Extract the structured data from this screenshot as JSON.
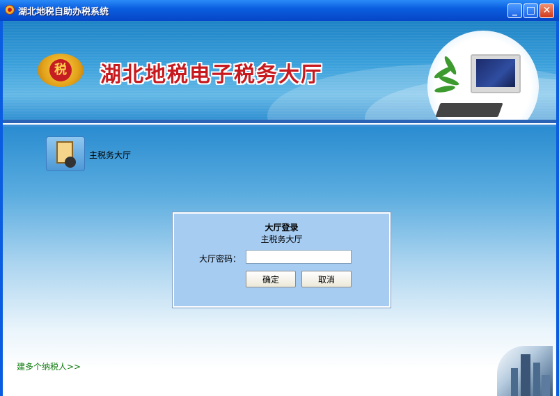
{
  "window": {
    "title": "湖北地税自助办税系统",
    "min_symbol": "_",
    "max_symbol": "□",
    "close_symbol": "✕"
  },
  "banner": {
    "title": "湖北地税电子税务大厅",
    "emblem_char": "税"
  },
  "hall": {
    "label": "主税务大厅"
  },
  "login": {
    "title": "大厅登录",
    "subtitle": "主税务大厅",
    "password_label": "大厅密码：",
    "password_value": "",
    "ok_label": "确定",
    "cancel_label": "取消"
  },
  "footer": {
    "multi_taxpayer_link": "建多个纳税人>>"
  },
  "icons": {
    "app": "tax-emblem-icon",
    "hall": "clipboard-person-icon"
  },
  "colors": {
    "title_bar": "#0b5ee0",
    "banner_title": "#c71a1f",
    "login_panel": "#a6ccf2",
    "link": "#0a7a0a"
  }
}
